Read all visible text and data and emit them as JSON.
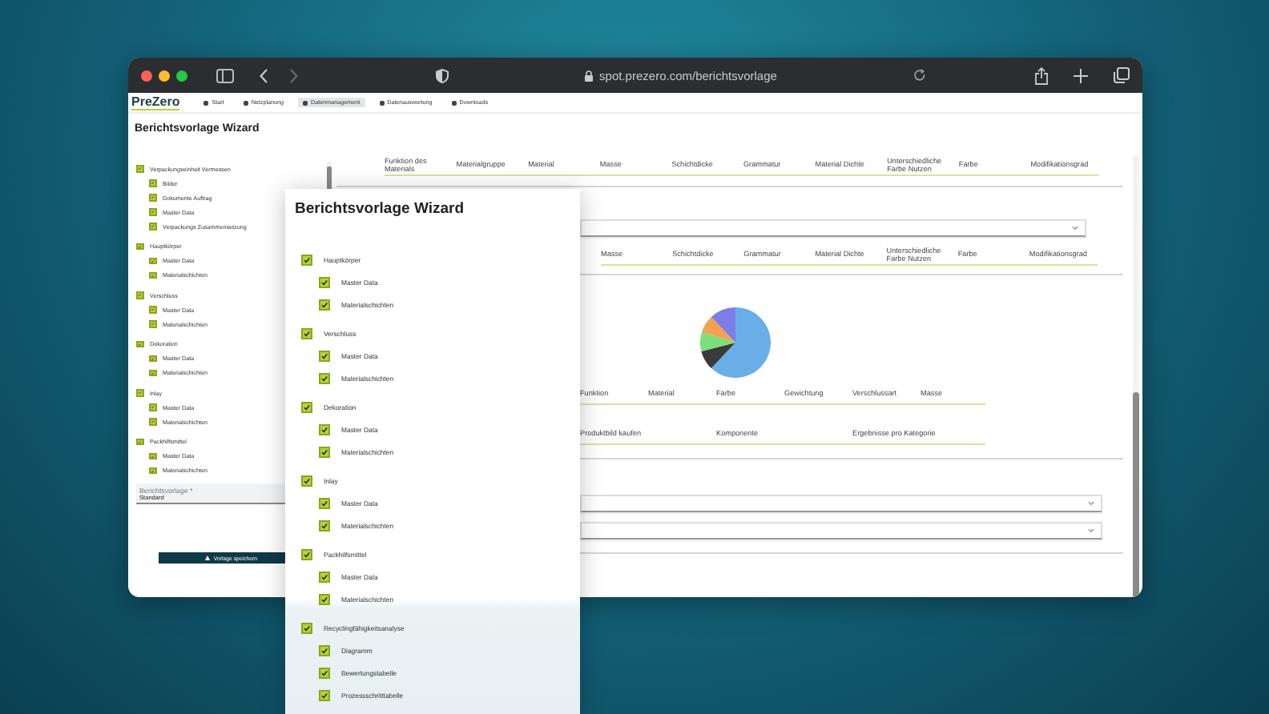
{
  "browser": {
    "url": "spot.prezero.com/berichtsvorlage"
  },
  "app": {
    "logo": "PreZero",
    "nav": [
      {
        "label": "Start",
        "selected": false
      },
      {
        "label": "Netzplanung",
        "selected": false
      },
      {
        "label": "Datenmanagement",
        "selected": true
      },
      {
        "label": "Datenauswertung",
        "selected": false
      },
      {
        "label": "Downloads",
        "selected": false
      }
    ],
    "title": "Berichtsvorlage Wizard"
  },
  "sidebar": {
    "groups": [
      {
        "label": "Verpackungseinheit Vermessen",
        "checked": true,
        "children": [
          {
            "label": "Bilder",
            "checked": true
          },
          {
            "label": "Dokumente Auftrag",
            "checked": true
          },
          {
            "label": "Master Data",
            "checked": true
          },
          {
            "label": "Verpackungs Zusammensetzung",
            "checked": true
          }
        ]
      },
      {
        "label": "Hauptkörper",
        "checked": true,
        "children": [
          {
            "label": "Master Data",
            "checked": true
          },
          {
            "label": "Materialschichten",
            "checked": true
          }
        ]
      },
      {
        "label": "Verschluss",
        "checked": true,
        "children": [
          {
            "label": "Master Data",
            "checked": true
          },
          {
            "label": "Materialschichten",
            "checked": true
          }
        ]
      },
      {
        "label": "Dekoration",
        "checked": true,
        "children": [
          {
            "label": "Master Data",
            "checked": true
          },
          {
            "label": "Materialschichten",
            "checked": true
          }
        ]
      },
      {
        "label": "Inlay",
        "checked": true,
        "children": [
          {
            "label": "Master Data",
            "checked": true
          },
          {
            "label": "Materialschichten",
            "checked": true
          }
        ]
      },
      {
        "label": "Packhilfsmittel",
        "checked": true,
        "children": [
          {
            "label": "Master Data",
            "checked": true
          },
          {
            "label": "Materialschichten",
            "checked": true
          }
        ]
      }
    ],
    "template_field": {
      "label": "Berichtsvorlage *",
      "value": "Standard"
    },
    "save_button": "Vorlage speichern"
  },
  "main": {
    "table_1": {
      "columns": [
        "Funktion des Materials",
        "Materialgruppe",
        "Material",
        "Masse",
        "Schichtdicke",
        "Grammatur",
        "Material Dichte",
        "Unterschiedliche Farbe Nutzen",
        "Farbe",
        "Modifikationsgrad"
      ]
    },
    "table_2": {
      "columns": [
        "Masse",
        "Schichtdicke",
        "Grammatur",
        "Material Dichte",
        "Unterschiedliche Farbe Nutzen",
        "Farbe",
        "Modifikationsgrad"
      ]
    },
    "table_3": {
      "columns": [
        "Funktion",
        "Material",
        "Farbe",
        "Gewichtung",
        "Verschlussart",
        "Masse"
      ]
    },
    "table_4": {
      "columns": [
        "Produktbild kaufen",
        "Komponente",
        "Ergebnisse pro Kategorie"
      ]
    }
  },
  "wizard": {
    "title": "Berichtsvorlage Wizard",
    "groups": [
      {
        "label": "Hauptkörper",
        "checked": true,
        "children": [
          {
            "label": "Master Data",
            "checked": true
          },
          {
            "label": "Materialschichten",
            "checked": true
          }
        ]
      },
      {
        "label": "Verschluss",
        "checked": true,
        "children": [
          {
            "label": "Master Data",
            "checked": true
          },
          {
            "label": "Materialschichten",
            "checked": true
          }
        ]
      },
      {
        "label": "Dekoration",
        "checked": true,
        "children": [
          {
            "label": "Master Data",
            "checked": true
          },
          {
            "label": "Materialschichten",
            "checked": true
          }
        ]
      },
      {
        "label": "Inlay",
        "checked": true,
        "children": [
          {
            "label": "Master Data",
            "checked": true
          },
          {
            "label": "Materialschichten",
            "checked": true
          }
        ]
      },
      {
        "label": "Packhilfsmittel",
        "checked": true,
        "children": [
          {
            "label": "Master Data",
            "checked": true
          },
          {
            "label": "Materialschichten",
            "checked": true
          }
        ]
      },
      {
        "label": "Recyclingfähigkeitsanalyse",
        "checked": true,
        "children": [
          {
            "label": "Diagramm",
            "checked": true
          },
          {
            "label": "Bewertungstabelle",
            "checked": true
          },
          {
            "label": "Prozessschritttabelle",
            "checked": true
          }
        ]
      }
    ]
  }
}
